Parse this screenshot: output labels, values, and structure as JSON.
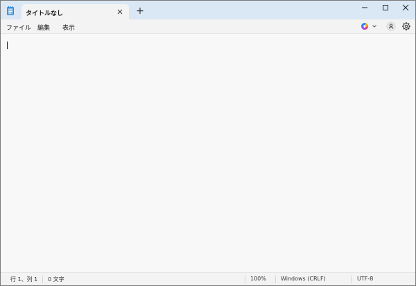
{
  "window": {
    "tab_title": "タイトルなし",
    "new_tab_symbol": "+"
  },
  "menu": {
    "file": "ファイル",
    "edit": "編集",
    "view": "表示"
  },
  "toolbar_icons": [
    "copilot-icon",
    "chevron-down-icon",
    "account-icon",
    "gear-icon"
  ],
  "editor": {
    "content": ""
  },
  "status": {
    "position": "行 1、列 1",
    "char_count": "0 文字",
    "zoom": "100%",
    "line_ending": "Windows (CRLF)",
    "encoding": "UTF-8"
  },
  "colors": {
    "titlebar": "#dae7f4",
    "tab": "#f3f3f3",
    "editor": "#f8f8f8",
    "app_icon": "#2b88d8"
  }
}
